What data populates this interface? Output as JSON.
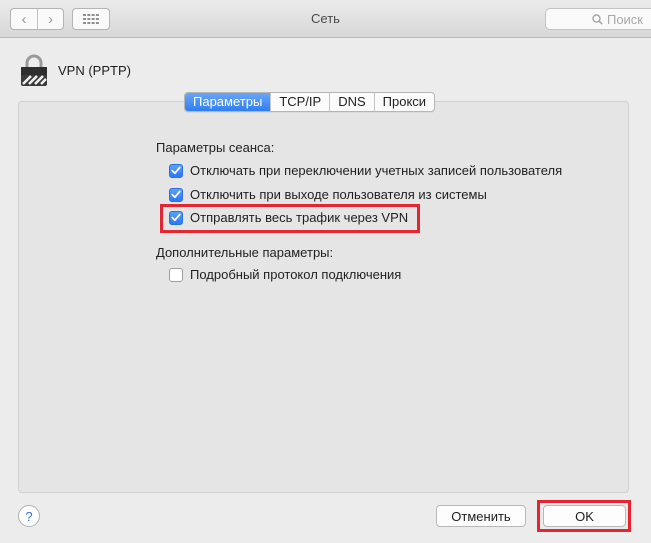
{
  "window": {
    "title": "Сеть",
    "search_placeholder": "Поиск",
    "back_glyph": "‹",
    "forward_glyph": "›"
  },
  "service": {
    "name": "VPN (PPTP)",
    "icon": "lock-icon"
  },
  "tabs": [
    {
      "label": "Параметры",
      "active": true
    },
    {
      "label": "TCP/IP",
      "active": false
    },
    {
      "label": "DNS",
      "active": false
    },
    {
      "label": "Прокси",
      "active": false
    }
  ],
  "session": {
    "label": "Параметры сеанса:",
    "options": [
      {
        "label": "Отключать при переключении учетных записей пользователя",
        "checked": true
      },
      {
        "label": "Отключить при выходе пользователя из системы",
        "checked": true
      },
      {
        "label": "Отправлять весь трафик через VPN",
        "checked": true
      }
    ]
  },
  "advanced": {
    "label": "Дополнительные параметры:",
    "options": [
      {
        "label": "Подробный протокол подключения",
        "checked": false
      }
    ]
  },
  "footer": {
    "help_label": "?",
    "cancel_label": "Отменить",
    "ok_label": "OK"
  },
  "colors": {
    "accent": "#2f7ff2",
    "highlight": "#e3262f"
  }
}
